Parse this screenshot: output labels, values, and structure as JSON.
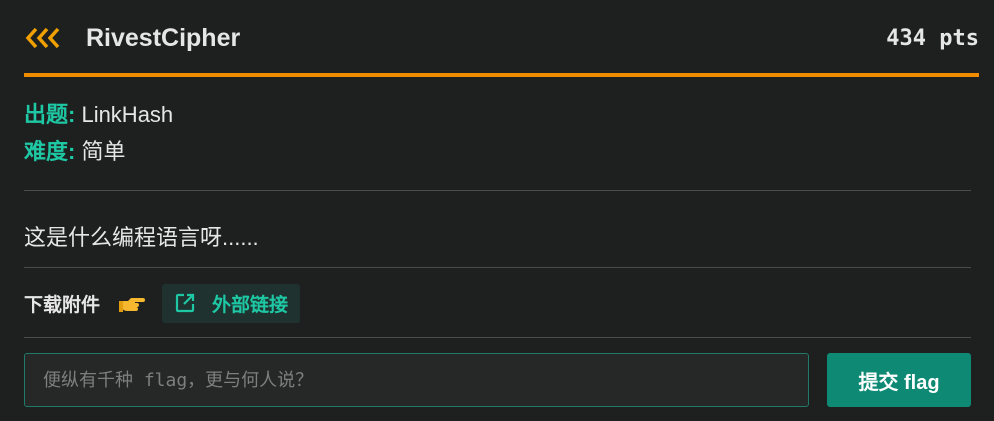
{
  "challenge": {
    "title": "RivestCipher",
    "points": "434 pts",
    "back_icon": "triple-chevron-left-icon"
  },
  "meta": {
    "author_label": "出题:",
    "author_value": "LinkHash",
    "difficulty_label": "难度:",
    "difficulty_value": "简单"
  },
  "description": "这是什么编程语言呀......",
  "attachments": {
    "label": "下载附件",
    "pointer_icon": "hand-pointing-right-icon",
    "external_link_label": "外部链接",
    "external_link_icon": "external-link-icon"
  },
  "flag_form": {
    "input_value": "",
    "input_placeholder": "便纵有千种 flag，更与何人说？",
    "submit_label": "提交 flag"
  },
  "colors": {
    "accent_orange": "#f08c00",
    "accent_teal": "#1ec8a4",
    "button_teal": "#0e8a74",
    "background": "#1e1f1f"
  }
}
